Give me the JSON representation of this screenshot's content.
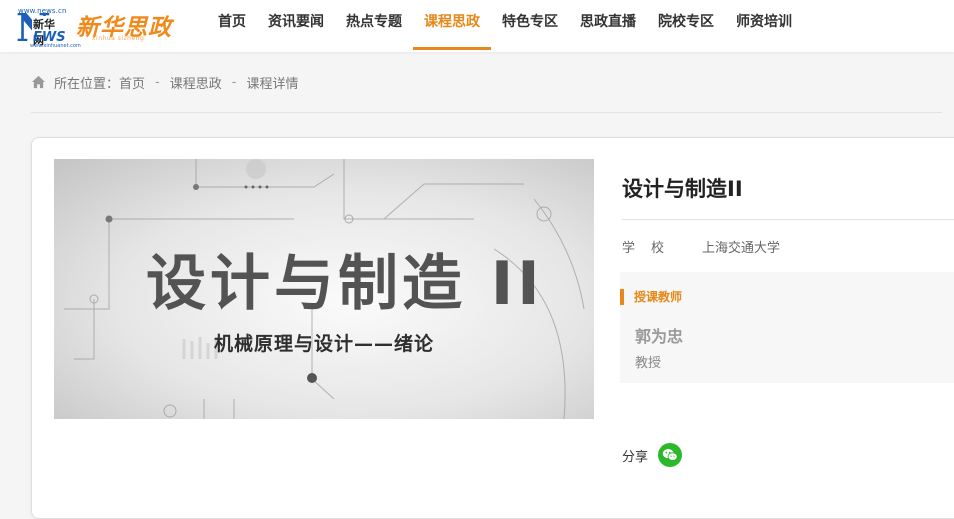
{
  "logo": {
    "site_url": "www.news.cn",
    "xinhua_small": "新华网",
    "ews": "EWS",
    "xinhua_url": "www.xinhuanet.com",
    "brand_title": "新华思政",
    "brand_sub": "xinhua sizheng"
  },
  "nav": {
    "items": [
      {
        "label": "首页"
      },
      {
        "label": "资讯要闻"
      },
      {
        "label": "热点专题"
      },
      {
        "label": "课程思政",
        "active": true
      },
      {
        "label": "特色专区"
      },
      {
        "label": "思政直播"
      },
      {
        "label": "院校专区"
      },
      {
        "label": "师资培训"
      }
    ],
    "accent_color": "#e5891a"
  },
  "breadcrumb": {
    "prefix": "所在位置：",
    "items": [
      "首页",
      "课程思政",
      "课程详情"
    ],
    "separator": "-"
  },
  "course": {
    "cover": {
      "title": "设计与制造 II",
      "subtitle": "机械原理与设计——绪论"
    },
    "name": "设计与制造II",
    "school_label": "学校",
    "school_value": "上海交通大学",
    "teacher_section_label": "授课教师",
    "teacher_name": "郭为忠",
    "teacher_title": "教授",
    "share_label": "分享",
    "share_icon": "wechat-icon"
  }
}
